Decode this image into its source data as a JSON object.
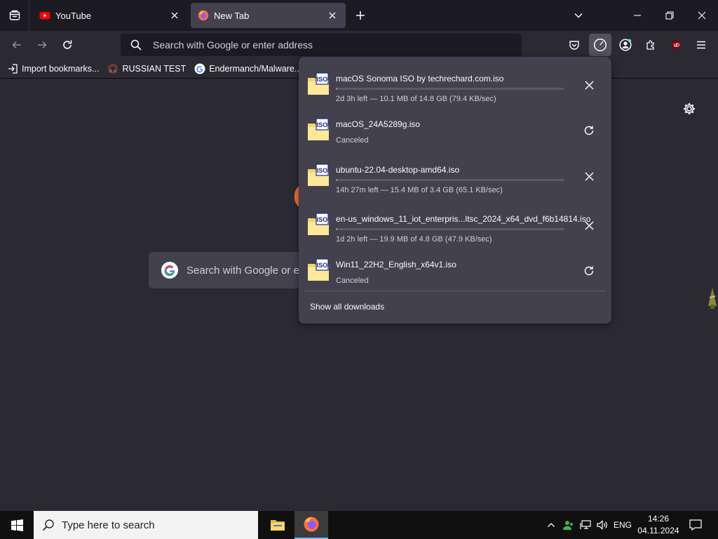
{
  "tabs": [
    {
      "title": "YouTube",
      "favicon": "youtube-icon",
      "active": false
    },
    {
      "title": "New Tab",
      "favicon": "firefox-icon",
      "active": true
    }
  ],
  "toolbar": {
    "urlbar_placeholder": "Search with Google or enter address"
  },
  "bookmarks": [
    {
      "label": "Import bookmarks...",
      "icon": "import-icon"
    },
    {
      "label": "RUSSIAN TEST",
      "icon": "github-octocat-icon"
    },
    {
      "label": "Endermanch/Malware...",
      "icon": "google-icon"
    }
  ],
  "newtab": {
    "search_placeholder": "Search with Google or e"
  },
  "downloads": {
    "items": [
      {
        "name": "macOS Sonoma ISO by techrechard.com.iso",
        "status": "2d 3h left — 10.1 MB of 14.8 GB (79.4 KB/sec)",
        "state": "downloading",
        "progress": 0.001,
        "action": "cancel"
      },
      {
        "name": "macOS_24A5289g.iso",
        "status": "Canceled",
        "state": "canceled",
        "action": "retry"
      },
      {
        "name": "ubuntu-22.04-desktop-amd64.iso",
        "status": "14h 27m left — 15.4 MB of 3.4 GB (65.1 KB/sec)",
        "state": "downloading",
        "progress": 0.004,
        "action": "cancel"
      },
      {
        "name": "en-us_windows_11_iot_enterpris...ltsc_2024_x64_dvd_f6b14814.iso",
        "status": "1d 2h left — 19.9 MB of 4.8 GB (47.9 KB/sec)",
        "state": "downloading",
        "progress": 0.004,
        "action": "cancel"
      },
      {
        "name": "Win11_22H2_English_x64v1.iso",
        "status": "Canceled",
        "state": "canceled",
        "action": "retry"
      }
    ],
    "show_all_label": "Show all downloads",
    "file_icon_label": "ISO"
  },
  "taskbar": {
    "search_placeholder": "Type here to search",
    "language": "ENG",
    "time": "14:26",
    "date": "04.11.2024"
  },
  "colors": {
    "tab_strip": "#1c1b22",
    "page_bg": "#2b2a33",
    "panel_bg": "#42414d",
    "youtube_red": "#ff0000",
    "firefox_orange": "#ff7139",
    "taskbar_bg": "#101010"
  }
}
